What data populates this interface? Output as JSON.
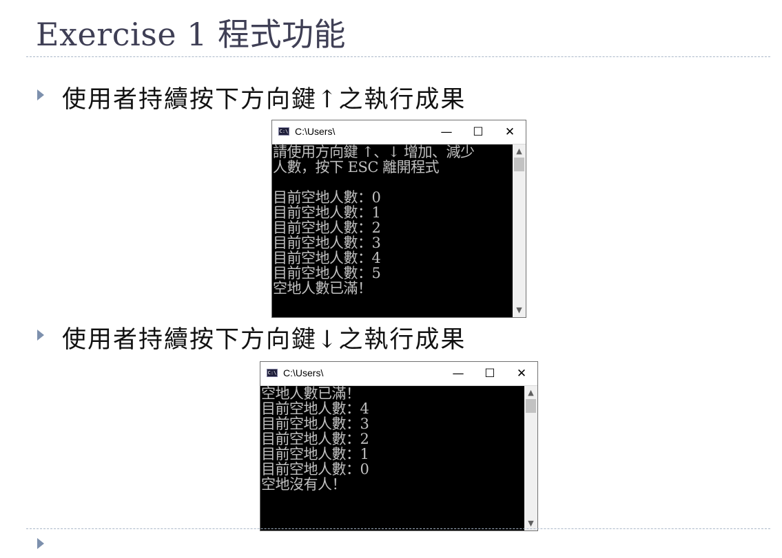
{
  "slide": {
    "title": "Exercise 1 程式功能",
    "bullets": [
      "使用者持續按下方向鍵↑之執行成果",
      "使用者持續按下方向鍵↓之執行成果"
    ]
  },
  "windows": [
    {
      "title": "C:\\Users\\",
      "icon": "C:\\",
      "controls": {
        "minimize": "—",
        "maximize": "☐",
        "close": "✕"
      },
      "lines": [
        "請使用方向鍵 ↑、↓ 增加、減少",
        "人數，按下 ESC 離開程式",
        "",
        "目前空地人數：0",
        "目前空地人數：1",
        "目前空地人數：2",
        "目前空地人數：3",
        "目前空地人數：4",
        "目前空地人數：5",
        "空地人數已滿！"
      ]
    },
    {
      "title": "C:\\Users\\",
      "icon": "C:\\",
      "controls": {
        "minimize": "—",
        "maximize": "☐",
        "close": "✕"
      },
      "lines": [
        "空地人數已滿！",
        "目前空地人數：4",
        "目前空地人數：3",
        "目前空地人數：2",
        "目前空地人數：1",
        "目前空地人數：0",
        "空地沒有人！"
      ]
    }
  ],
  "colors": {
    "console_bg": "#000000",
    "console_text": "#c0c0c0",
    "title_text": "#3f3f55",
    "bullet": "#7d90ad",
    "dash_line": "#a9b7c8"
  }
}
